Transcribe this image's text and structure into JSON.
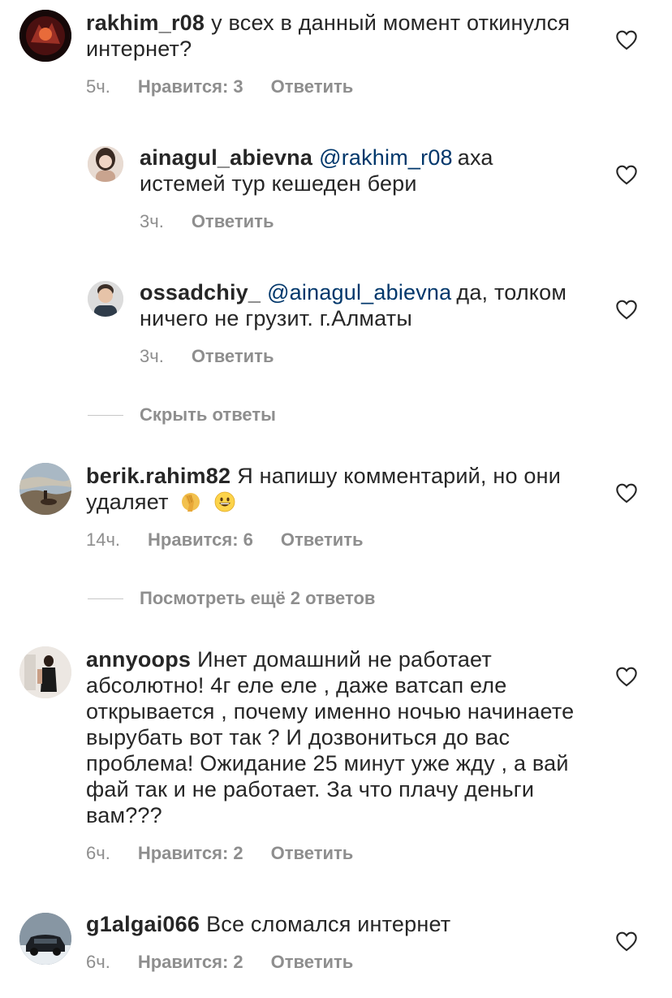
{
  "comments": [
    {
      "username": "rakhim_r08",
      "text": "у всех в данный момент откинулся интернет?",
      "time": "5ч.",
      "likes": "Нравится: 3",
      "reply": "Ответить"
    },
    {
      "username": "ainagul_abievna",
      "mention": "@rakhim_r08",
      "text": "аха истемей тур кешеден бери",
      "time": "3ч.",
      "reply": "Ответить"
    },
    {
      "username": "ossadchiy_",
      "mention": "@ainagul_abievna",
      "text": "да, толком ничего не грузит. г.Алматы",
      "time": "3ч.",
      "reply": "Ответить"
    },
    {
      "username": "berik.rahim82",
      "text": "Я напишу комментарий, но они удаляет",
      "emojis": [
        "face-palm-emoji",
        "grinning-face-emoji"
      ],
      "time": "14ч.",
      "likes": "Нравится: 6",
      "reply": "Ответить"
    },
    {
      "username": "annyoops",
      "text": "Инет домашний не работает абсолютно! 4г еле еле , даже ватсап еле открывается , почему именно ночью начинаете вырубать вот так ? И дозвониться до вас проблема! Ожидание 25 минут уже жду , а вай фай так и не работает. За что плачу деньги вам???",
      "time": "6ч.",
      "likes": "Нравится: 2",
      "reply": "Ответить"
    },
    {
      "username": "g1algai066",
      "text": "Все сломался интернет",
      "time": "6ч.",
      "likes": "Нравится: 2",
      "reply": "Ответить"
    }
  ],
  "toggles": {
    "hide_replies": "Скрыть ответы",
    "view_more": "Посмотреть ещё 2 ответов"
  },
  "icons": {
    "like": "heart-outline-icon"
  },
  "colors": {
    "text": "#262626",
    "muted": "#8e8e8e",
    "mention": "#00376b",
    "divider": "#c7c7c7"
  }
}
